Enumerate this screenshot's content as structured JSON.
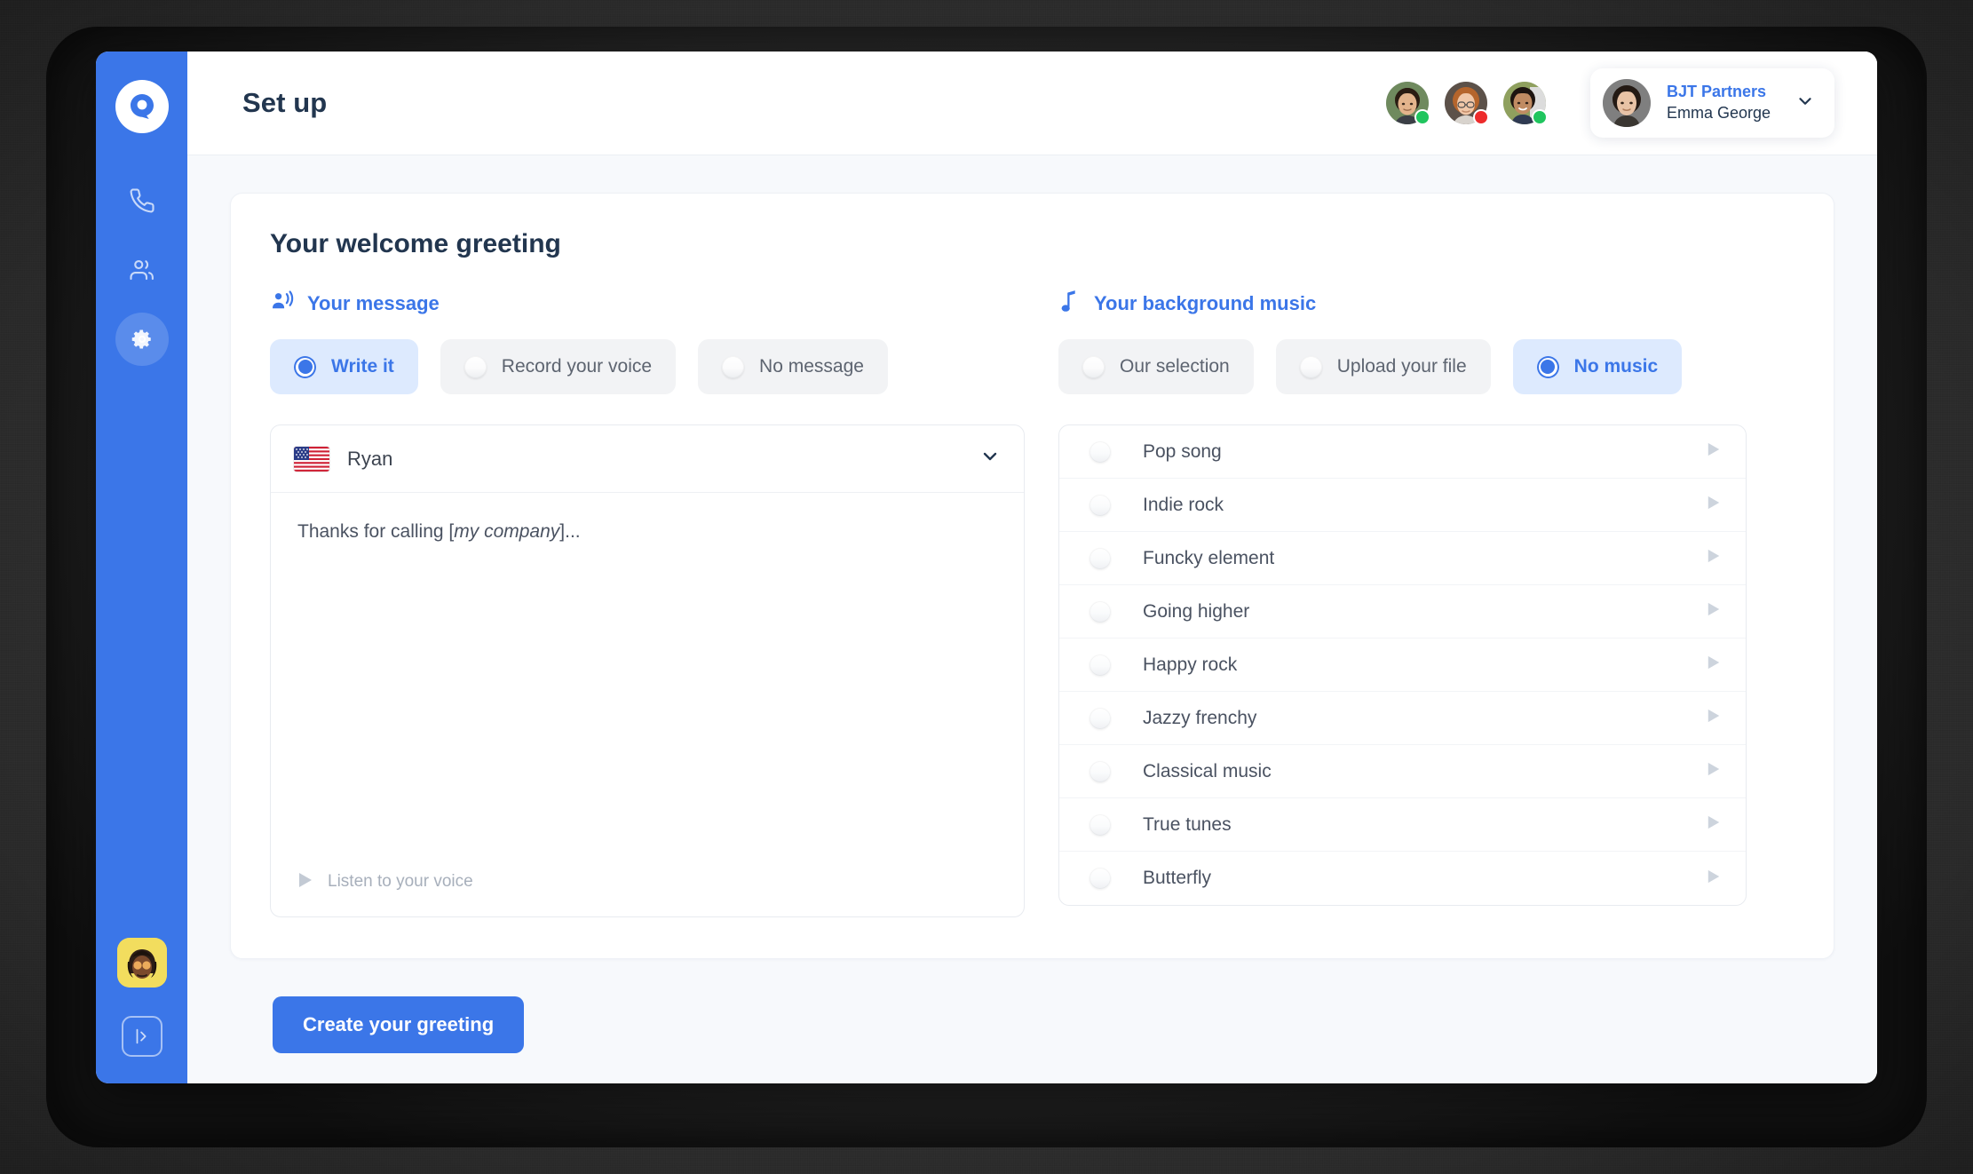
{
  "window": {
    "brand_logo_icon": "speech-bubble-q-logo"
  },
  "sidebar": {
    "items": [
      {
        "icon": "phone-icon",
        "name": "calls",
        "active": false
      },
      {
        "icon": "users-icon",
        "name": "contacts",
        "active": false
      },
      {
        "icon": "gear-icon",
        "name": "settings",
        "active": true
      }
    ],
    "user_avatar_icon": "user-avatar",
    "collapse_icon": "collapse-panel-icon"
  },
  "header": {
    "title": "Set up",
    "presence": [
      {
        "name": "teammate-1",
        "status": "online",
        "status_color": "#20c55e"
      },
      {
        "name": "teammate-2",
        "status": "busy",
        "status_color": "#ed2b2b"
      },
      {
        "name": "teammate-3",
        "status": "online",
        "status_color": "#20c55e"
      }
    ],
    "account": {
      "organization": "BJT Partners",
      "user": "Emma George",
      "chevron_icon": "chevron-down-icon"
    }
  },
  "main": {
    "card_title": "Your welcome greeting",
    "message_section": {
      "icon": "speaking-person-icon",
      "label": "Your message",
      "options": [
        {
          "label": "Write it",
          "selected": true
        },
        {
          "label": "Record your voice",
          "selected": false
        },
        {
          "label": "No message",
          "selected": false
        }
      ],
      "voice": {
        "flag": "us-flag",
        "name": "Ryan",
        "chevron_icon": "chevron-down-icon"
      },
      "text_prefix": "Thanks for calling [",
      "text_variable": "my company",
      "text_suffix": "]...",
      "listen": {
        "icon": "play-triangle-icon",
        "label": "Listen to your voice"
      }
    },
    "music_section": {
      "icon": "music-note-icon",
      "label": "Your background music",
      "options": [
        {
          "label": "Our selection",
          "selected": false
        },
        {
          "label": "Upload your file",
          "selected": false
        },
        {
          "label": "No music",
          "selected": true
        }
      ],
      "tracks": [
        {
          "name": "Pop song",
          "selected": false,
          "play_icon": "play-triangle-icon"
        },
        {
          "name": "Indie rock",
          "selected": false,
          "play_icon": "play-triangle-icon"
        },
        {
          "name": "Funcky element",
          "selected": false,
          "play_icon": "play-triangle-icon"
        },
        {
          "name": "Going higher",
          "selected": false,
          "play_icon": "play-triangle-icon"
        },
        {
          "name": "Happy rock",
          "selected": false,
          "play_icon": "play-triangle-icon"
        },
        {
          "name": "Jazzy frenchy",
          "selected": false,
          "play_icon": "play-triangle-icon"
        },
        {
          "name": "Classical music",
          "selected": false,
          "play_icon": "play-triangle-icon"
        },
        {
          "name": "True tunes",
          "selected": false,
          "play_icon": "play-triangle-icon"
        },
        {
          "name": "Butterfly",
          "selected": false,
          "play_icon": "play-triangle-icon"
        }
      ]
    }
  },
  "footer": {
    "create_label": "Create your greeting"
  },
  "colors": {
    "accent": "#3b76e8",
    "accent_soft": "#ddeafe",
    "title": "#22364f",
    "pill_idle": "#f2f3f5",
    "page_bg": "#f7f9fc",
    "online": "#20c55e",
    "busy": "#ed2b2b"
  }
}
